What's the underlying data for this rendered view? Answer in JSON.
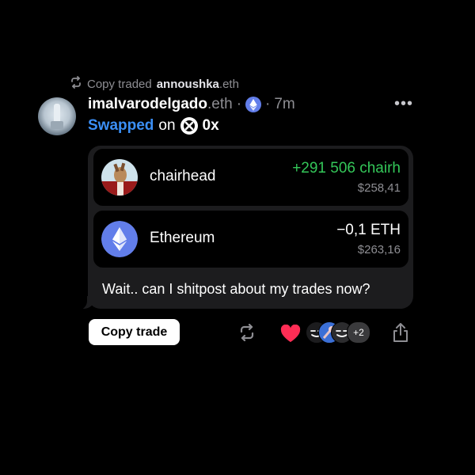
{
  "repost": {
    "prefix": "Copy traded",
    "user": "annoushka",
    "suffix": ".eth",
    "icon": "repost-icon"
  },
  "post": {
    "author_name": "imalvarodelgado",
    "author_suffix": ".eth",
    "sep1": "·",
    "sep2": "·",
    "time": "7m",
    "chain_icon": "ethereum-icon",
    "more_icon": "more-dots-icon",
    "more_label": "•••",
    "action_verb": "Swapped",
    "action_on": "on",
    "dex_name": "0x",
    "dex_icon": "0x-icon"
  },
  "swap": {
    "received": {
      "token_name": "chairhead",
      "amount": "+291 506 chairh",
      "usd": "$258,41",
      "color": "#34c759"
    },
    "sent": {
      "token_name": "Ethereum",
      "amount": "−0,1 ETH",
      "usd": "$263,16"
    }
  },
  "message": "Wait.. can I shitpost about my trades now?",
  "actions": {
    "copy_trade_label": "Copy trade",
    "repost_icon": "repost-icon",
    "like_icon": "heart-icon",
    "liked": true,
    "likers_more": "+2",
    "share_icon": "share-icon"
  },
  "colors": {
    "background": "#000000",
    "card": "#1c1c1e",
    "accent_blue": "#3b8ff6",
    "positive": "#34c759",
    "like": "#ff2d55",
    "muted": "#8e8e93",
    "eth": "#627eea"
  }
}
